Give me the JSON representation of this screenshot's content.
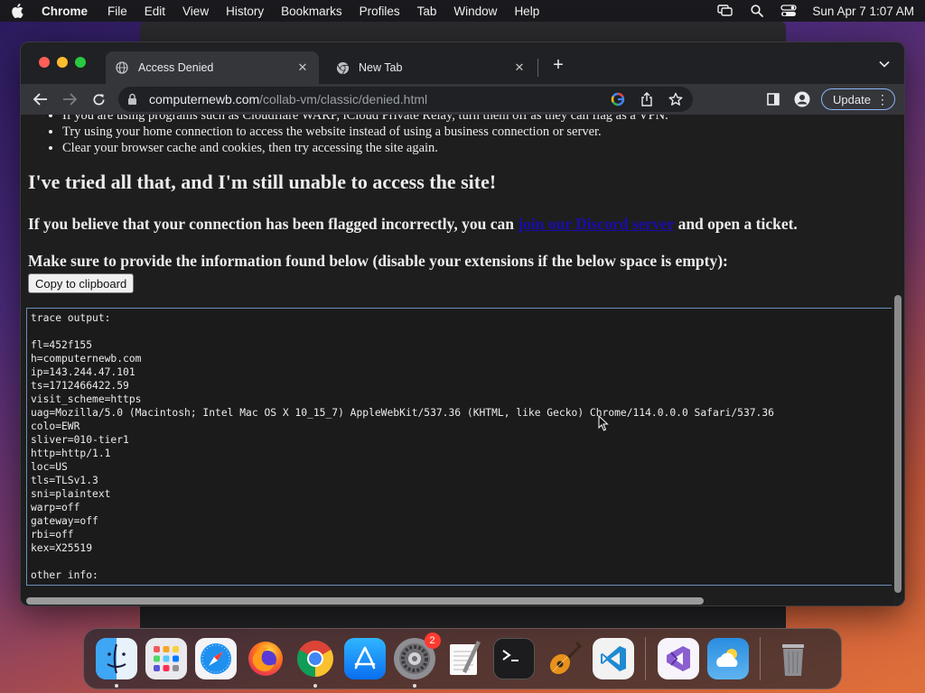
{
  "menubar": {
    "app_name": "Chrome",
    "items": [
      "File",
      "Edit",
      "View",
      "History",
      "Bookmarks",
      "Profiles",
      "Tab",
      "Window",
      "Help"
    ],
    "clock": "Sun Apr 7  1:07 AM",
    "icons": [
      "apple-icon",
      "screen-mirror-icon",
      "spotlight-search-icon",
      "control-center-icon"
    ]
  },
  "tabs": [
    {
      "title": "Access Denied",
      "active": true,
      "favicon": "globe-icon"
    },
    {
      "title": "New Tab",
      "active": false,
      "favicon": "chrome-icon"
    }
  ],
  "omnibox": {
    "host": "computernewb.com",
    "path": "/collab-vm/classic/denied.html"
  },
  "toolbar": {
    "update_label": "Update"
  },
  "page": {
    "bullets": [
      "If you are using programs such as Cloudflare WARP, iCloud Private Relay, turn them off as they can flag as a VPN.",
      "Try using your home connection to access the website instead of using a business connection or server.",
      "Clear your browser cache and cookies, then try accessing the site again."
    ],
    "heading_tried": "I've tried all that, and I'm still unable to access the site!",
    "believe_prefix": "If you believe that your connection has been flagged incorrectly, you can ",
    "believe_link": "join our Discord server",
    "believe_suffix": " and open a ticket.",
    "heading_sure": "Make sure to provide the information found below (disable your extensions if the below space is empty):",
    "copy_button": "Copy to clipboard",
    "trace_lines": [
      "trace output:",
      "",
      "fl=452f155",
      "h=computernewb.com",
      "ip=143.244.47.101",
      "ts=1712466422.59",
      "visit_scheme=https",
      "uag=Mozilla/5.0 (Macintosh; Intel Mac OS X 10_15_7) AppleWebKit/537.36 (KHTML, like Gecko) Chrome/114.0.0.0 Safari/537.36",
      "colo=EWR",
      "sliver=010-tier1",
      "http=http/1.1",
      "loc=US",
      "tls=TLSv1.3",
      "sni=plaintext",
      "warp=off",
      "gateway=off",
      "rbi=off",
      "kex=X25519",
      "",
      "other info:"
    ]
  },
  "dock": {
    "apps": [
      {
        "name": "finder",
        "running": true
      },
      {
        "name": "launchpad",
        "running": false
      },
      {
        "name": "safari",
        "running": false
      },
      {
        "name": "firefox",
        "running": false
      },
      {
        "name": "chrome",
        "running": true
      },
      {
        "name": "app-store",
        "running": false
      },
      {
        "name": "system-settings",
        "running": true,
        "badge": "2"
      },
      {
        "name": "textedit",
        "running": false
      },
      {
        "name": "terminal",
        "running": false
      },
      {
        "name": "garageband",
        "running": false
      },
      {
        "name": "vscode",
        "running": false
      },
      {
        "name": "visual-studio",
        "running": false
      },
      {
        "name": "weather",
        "running": false
      },
      {
        "name": "trash",
        "running": false
      }
    ]
  }
}
